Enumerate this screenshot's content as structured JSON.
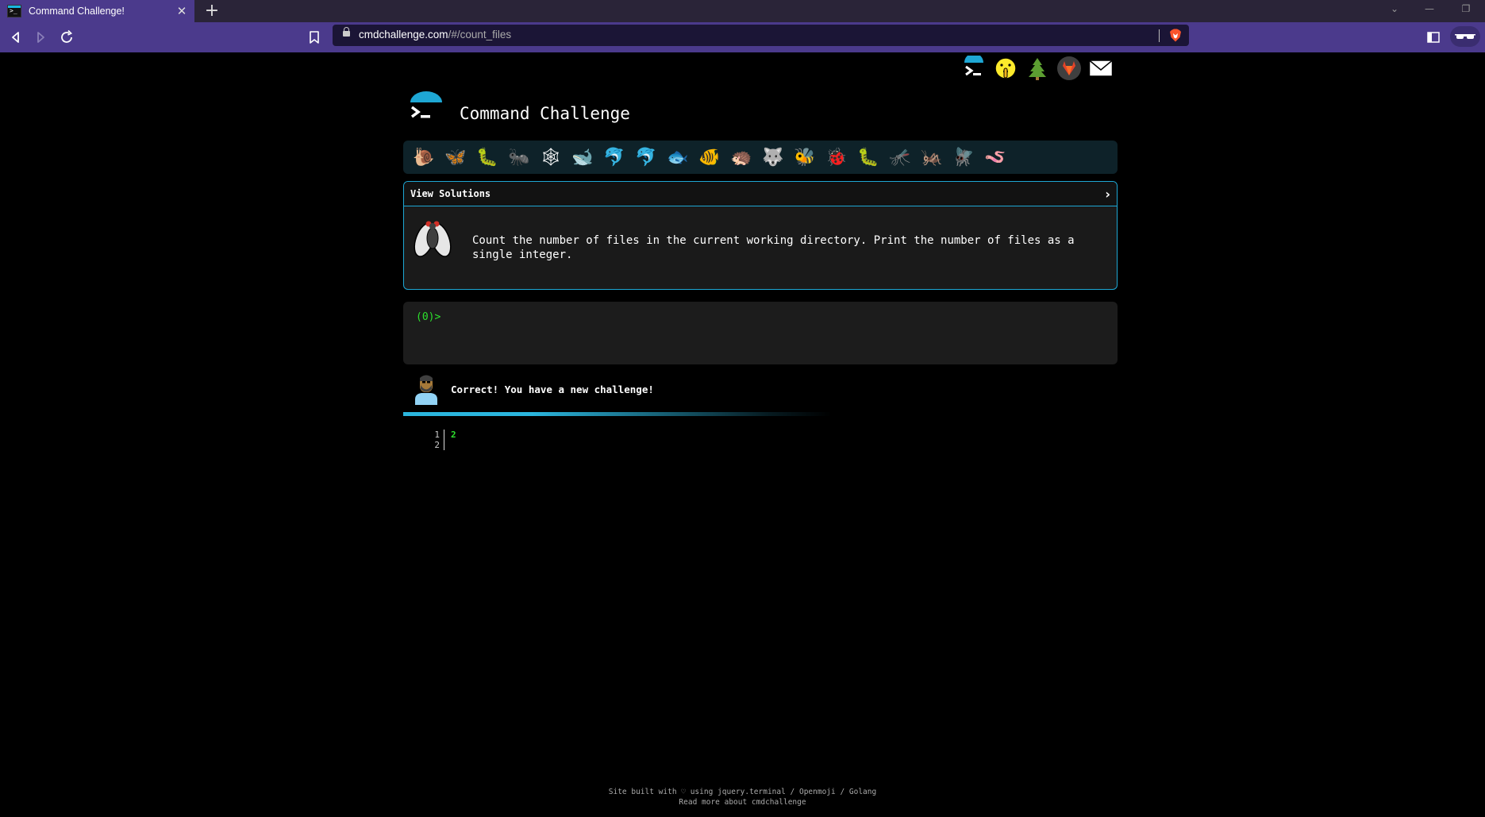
{
  "browser": {
    "tab_title": "Command Challenge!",
    "tab_close": "✕",
    "new_tab": "+",
    "url_domain": "cmdchallenge.com",
    "url_path": "/#/count_files"
  },
  "page": {
    "site_title": "Command Challenge",
    "top_icons": [
      "terminal-icon",
      "shushing-face-icon",
      "tree-icon",
      "gitlab-icon",
      "envelope-icon"
    ],
    "critters": [
      "🐌",
      "🦋",
      "🐛",
      "🐜",
      "🕸",
      "🐋",
      "🐬",
      "🐬",
      "🐟",
      "🐠",
      "🦔",
      "🐺",
      "🐝",
      "🐞",
      "🐛",
      "🦟",
      "🦗",
      "🪰",
      "🪱"
    ],
    "challenge": {
      "view_solutions": "View Solutions",
      "chevron": "›",
      "description": "Count the number of files in the current working directory. Print the number of files as a single integer."
    },
    "terminal": {
      "prompt": "(0)>"
    },
    "feedback": "Correct! You have a new challenge!",
    "output": {
      "line_numbers": [
        "1",
        "2"
      ],
      "text": "2"
    },
    "footer": {
      "line1": "Site built with ♡ using jquery.terminal / Openmoji / Golang",
      "line2": "Read more about cmdchallenge"
    }
  },
  "colors": {
    "accent": "#1ea7d4",
    "prompt_green": "#2de02d",
    "browser_purple": "#4b3a8c"
  }
}
